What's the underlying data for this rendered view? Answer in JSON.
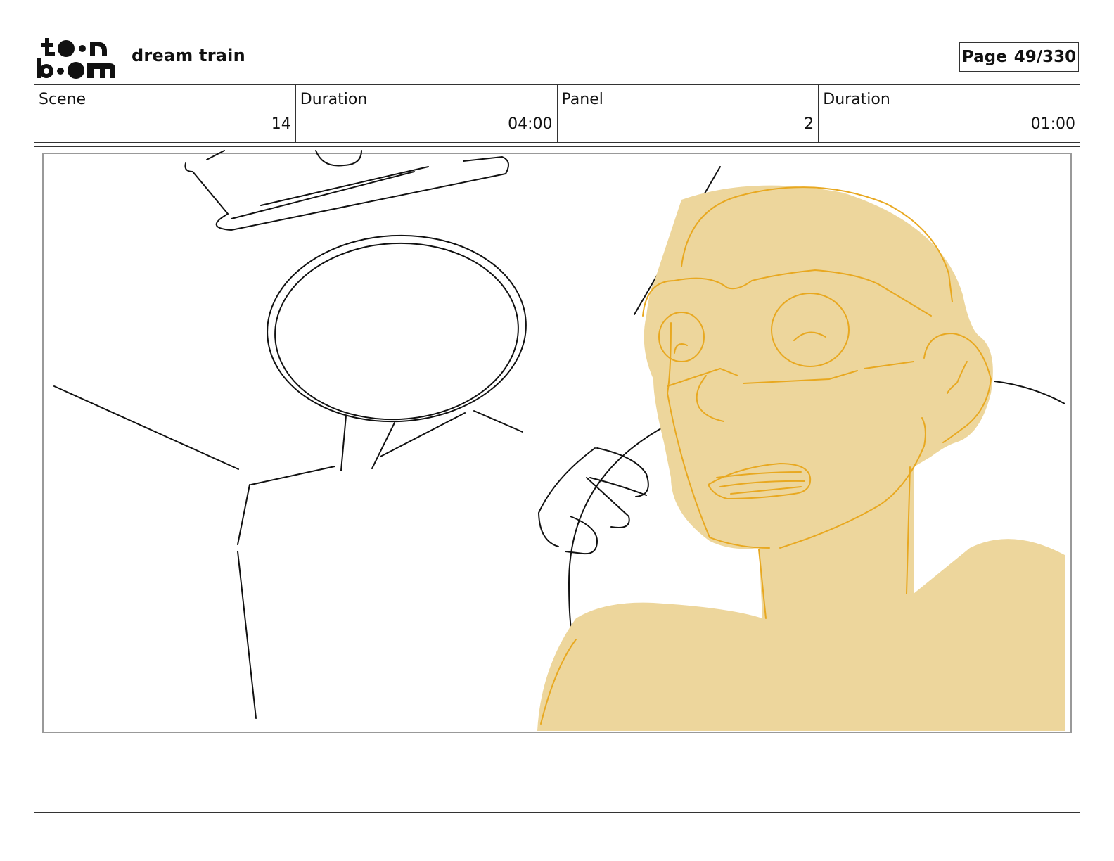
{
  "header": {
    "logo_text": "toonboom",
    "logo_icon": "toon-boom-logo-icon",
    "project_title": "dream train",
    "page_label": "Page",
    "page_number": "49/330"
  },
  "info": {
    "scene_label": "Scene",
    "scene_value": "14",
    "scene_duration_label": "Duration",
    "scene_duration_value": "04:00",
    "panel_label": "Panel",
    "panel_value": "2",
    "panel_duration_label": "Duration",
    "panel_duration_value": "01:00"
  },
  "panel": {
    "image_icon": "storyboard-sketch-image",
    "sketch_stroke_color": "#111111",
    "character_fill_color": "#EDD69C",
    "character_line_color": "#E8A820"
  },
  "notes": {
    "text": ""
  }
}
